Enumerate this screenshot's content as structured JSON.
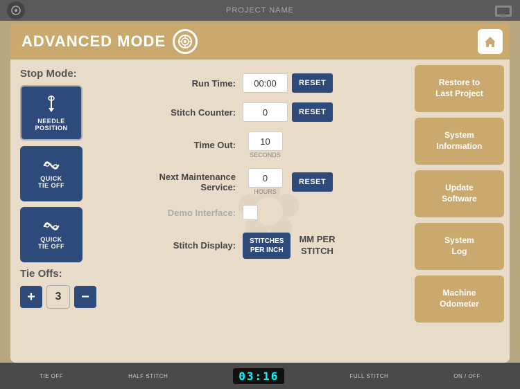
{
  "topBar": {
    "title": "PROJECT NAME"
  },
  "header": {
    "title": "ADVANCED MODE",
    "homeIcon": "⌂"
  },
  "stopMode": {
    "label": "Stop Mode:",
    "buttons": [
      {
        "line1": "NEEDLE",
        "line2": "POSITION",
        "icon": "needle"
      },
      {
        "line1": "QUICK",
        "line2": "TIE OFF",
        "icon": "knot"
      },
      {
        "line1": "QUICK",
        "line2": "TIE OFF",
        "icon": "knot"
      }
    ]
  },
  "tieOffs": {
    "label": "Tie Offs:",
    "count": "3",
    "plusLabel": "+",
    "minusLabel": "−"
  },
  "form": {
    "runTime": {
      "label": "Run Time:",
      "value": "00:00",
      "resetLabel": "RESET"
    },
    "stitchCounter": {
      "label": "Stitch Counter:",
      "value": "0",
      "resetLabel": "RESET"
    },
    "timeOut": {
      "label": "Time Out:",
      "value": "10",
      "sublabel": "SECONDS"
    },
    "nextMaintenance": {
      "label": "Next Maintenance Service:",
      "value": "0",
      "sublabel": "HOURS",
      "resetLabel": "RESET"
    },
    "demoInterface": {
      "label": "Demo Interface:"
    },
    "stitchDisplay": {
      "label": "Stitch Display:",
      "option1": "STITCHES\nPER INCH",
      "option2": "MM PER\nSTITCH"
    }
  },
  "rightPanel": {
    "buttons": [
      {
        "label": "Restore to\nLast Project"
      },
      {
        "label": "System\nInformation"
      },
      {
        "label": "Update\nSoftware"
      },
      {
        "label": "System\nLog"
      },
      {
        "label": "Machine\nOdometer"
      }
    ]
  },
  "bottomBar": {
    "items": [
      "TIE OFF",
      "HALF STITCH",
      "FULL STITCH",
      "ON / OFF"
    ],
    "time": "03:16"
  }
}
